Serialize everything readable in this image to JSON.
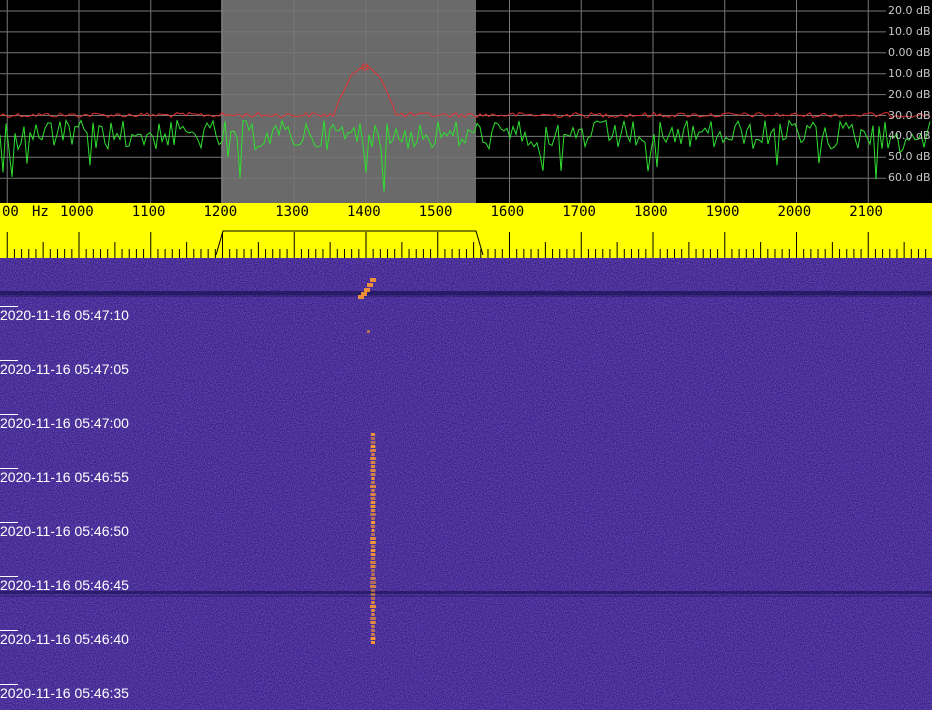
{
  "spectrum": {
    "db_labels": [
      "20.0 dB",
      "10.0 dB",
      "0.00 dB",
      "10.0 dB",
      "20.0 dB",
      "30.0 dB",
      "40.0 dB",
      "50.0 dB",
      "60.0 dB"
    ],
    "selection_colour": "#6a6a6a",
    "peak_trace_colour": "#e03030",
    "live_trace_colour": "#30e030"
  },
  "frequency_scale": {
    "unit": "Hz",
    "leading_label": "00",
    "labels": [
      "1000",
      "1100",
      "1200",
      "1300",
      "1400",
      "1500",
      "1600",
      "1700",
      "1800",
      "1900",
      "2000",
      "2100"
    ],
    "background": "#ffff00"
  },
  "waterfall": {
    "timestamps": [
      "2020-11-16 05:47:10",
      "2020-11-16 05:47:05",
      "2020-11-16 05:47:00",
      "2020-11-16 05:46:55",
      "2020-11-16 05:46:50",
      "2020-11-16 05:46:45",
      "2020-11-16 05:46:40",
      "2020-11-16 05:46:35"
    ],
    "background": "#3a1f8c",
    "signal_colour": "#ff9a30"
  }
}
